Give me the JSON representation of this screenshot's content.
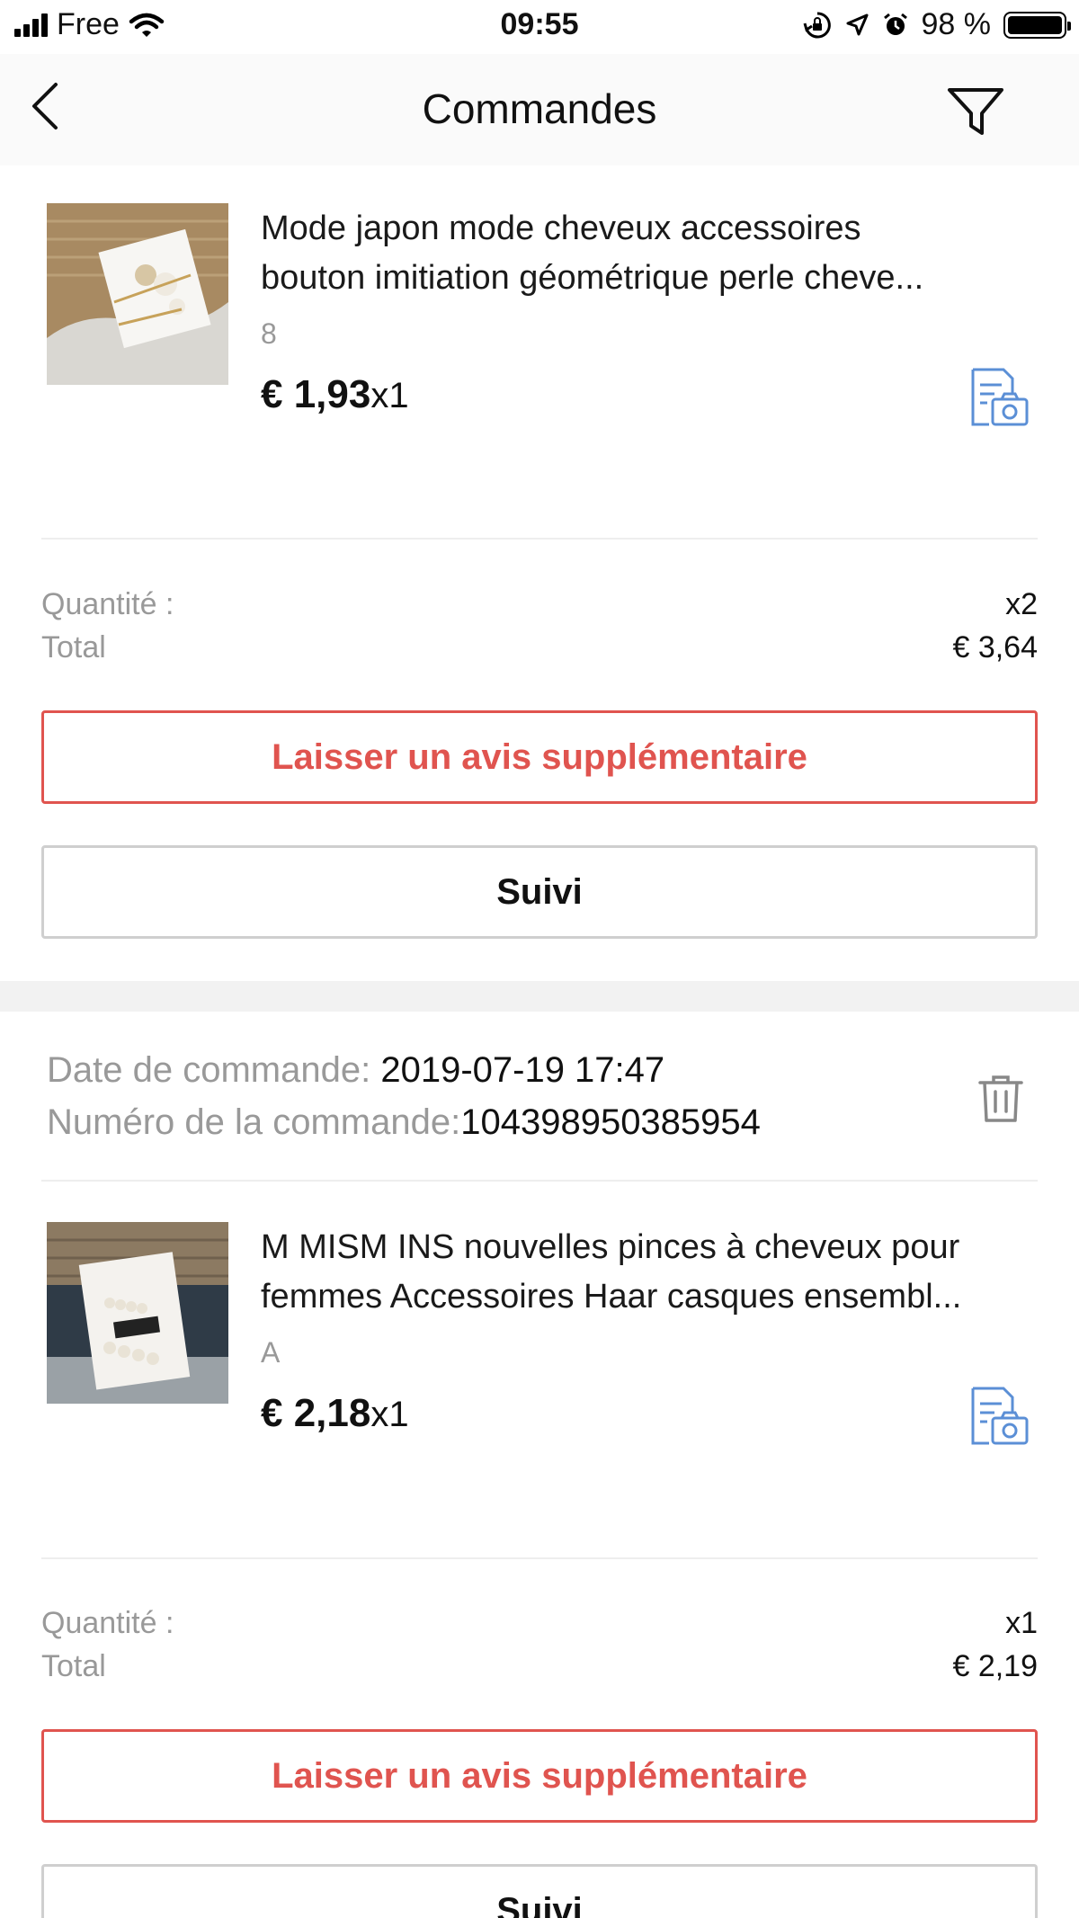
{
  "status_bar": {
    "carrier": "Free",
    "time": "09:55",
    "battery": "98 %",
    "battery_level": 0.98
  },
  "nav": {
    "title": "Commandes",
    "back_icon": "chevron-left-icon",
    "filter_icon": "filter-icon"
  },
  "orders": [
    {
      "product": {
        "title_line1": "Mode japon mode cheveux accessoires",
        "title_line2": "bouton imitiation géométrique perle cheve...",
        "variant": "8",
        "price": "€ 1,93",
        "qty": "x1"
      },
      "summary": {
        "quantity_label": "Quantité :",
        "quantity_value": "x2",
        "total_label": "Total",
        "total_value": "€ 3,64"
      },
      "review_button": "Laisser un avis supplémentaire",
      "track_button": "Suivi"
    },
    {
      "date_label": "Date de commande:",
      "date_value": "2019-07-19 17:47",
      "number_label": "Numéro de la commande:",
      "number_value": "104398950385954",
      "product": {
        "title_line1": "M MISM INS nouvelles pinces à cheveux pour",
        "title_line2": "femmes Accessoires Haar casques ensembl...",
        "variant": "A",
        "price": "€ 2,18",
        "qty": "x1"
      },
      "summary": {
        "quantity_label": "Quantité :",
        "quantity_value": "x1",
        "total_label": "Total",
        "total_value": "€ 2,19"
      },
      "review_button": "Laisser un avis supplémentaire",
      "track_button": "Suivi"
    }
  ],
  "colors": {
    "accent_red": "#e0544f",
    "icon_blue": "#5b8fd6",
    "muted_text": "#999999"
  }
}
